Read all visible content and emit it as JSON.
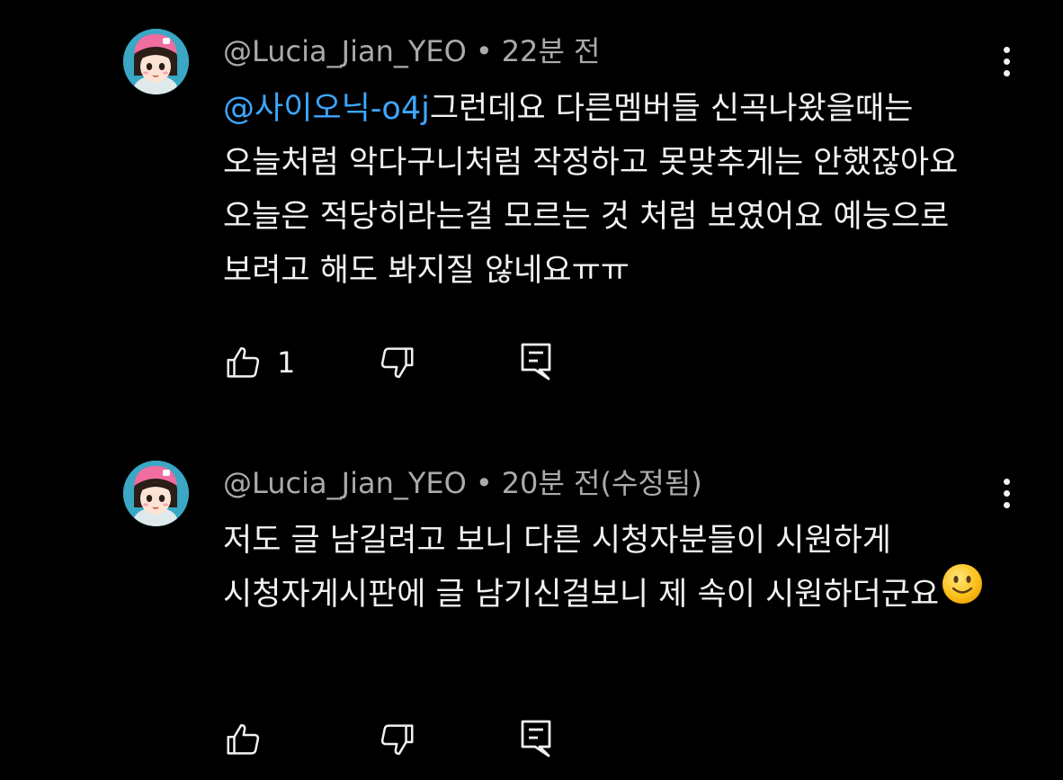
{
  "comments": [
    {
      "author": "@Lucia_Jian_YEO",
      "separator": "•",
      "time": "22분 전",
      "mention": "@사이오닉-o4j",
      "text": "그런데요 다른멤버들 신곡나왔을때는 오늘처럼 악다구니처럼 작정하고 못맞추게는 안했잖아요 오늘은 적당히라는걸 모르는 것 처럼 보였어요 예능으로 보려고 해도 봐지질 않네요ㅠㅠ",
      "likes": "1",
      "icons": [
        "avatar",
        "more-vert-icon",
        "thumb-up-icon",
        "thumb-down-icon",
        "reply-icon"
      ]
    },
    {
      "author": "@Lucia_Jian_YEO",
      "separator": "•",
      "time": "20분 전(수정됨)",
      "mention": "",
      "text": "저도 글 남길려고 보니 다른 시청자분들이 시원하게 시청자게시판에 글 남기신걸보니 제 속이 시원하더군요",
      "emoji": "slightly-smiling-face",
      "likes": "",
      "icons": [
        "avatar",
        "more-vert-icon",
        "thumb-up-icon",
        "thumb-down-icon",
        "reply-icon"
      ]
    }
  ],
  "colors": {
    "background": "#000000",
    "text": "#f1f1f1",
    "meta": "#aaaaaa",
    "mention": "#3ea6ff",
    "avatar_bg": "#3aa7c4"
  }
}
